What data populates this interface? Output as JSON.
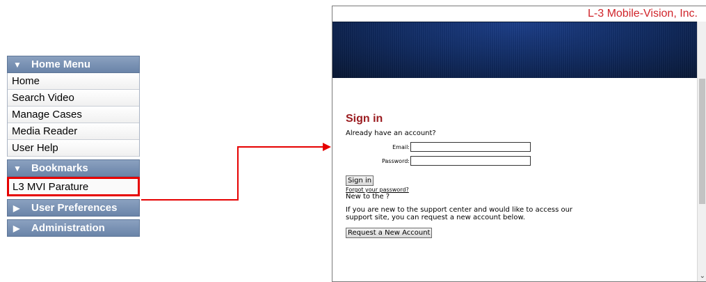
{
  "menu": {
    "home_menu_header": "Home Menu",
    "home_items": [
      "Home",
      "Search Video",
      "Manage Cases",
      "Media Reader",
      "User Help"
    ],
    "bookmarks_header": "Bookmarks",
    "bookmark_item": "L3 MVI Parature",
    "user_prefs_header": "User Preferences",
    "admin_header": "Administration",
    "collapsed_icon": "triangle-down",
    "expanded_icon": "triangle-right"
  },
  "browser": {
    "brand": "L-3 Mobile-Vision, Inc.",
    "sign_in_title": "Sign in",
    "already": "Already have an account?",
    "email_label": "Email:",
    "email_value": "",
    "password_label": "Password:",
    "password_value": "",
    "sign_in_button": "Sign in",
    "forgot_link": "Forgot your password?",
    "new_to": "New to the ?",
    "info_line1": "If you are new to the support center and would like to access our",
    "info_line2": "support site, you can request a new account below.",
    "request_button": "Request a New Account"
  },
  "colors": {
    "highlight": "#e60000",
    "menu_header": "#6a84a8",
    "brand_text": "#d0242a",
    "sign_in_title": "#9b1c20",
    "banner": "#10295d"
  }
}
